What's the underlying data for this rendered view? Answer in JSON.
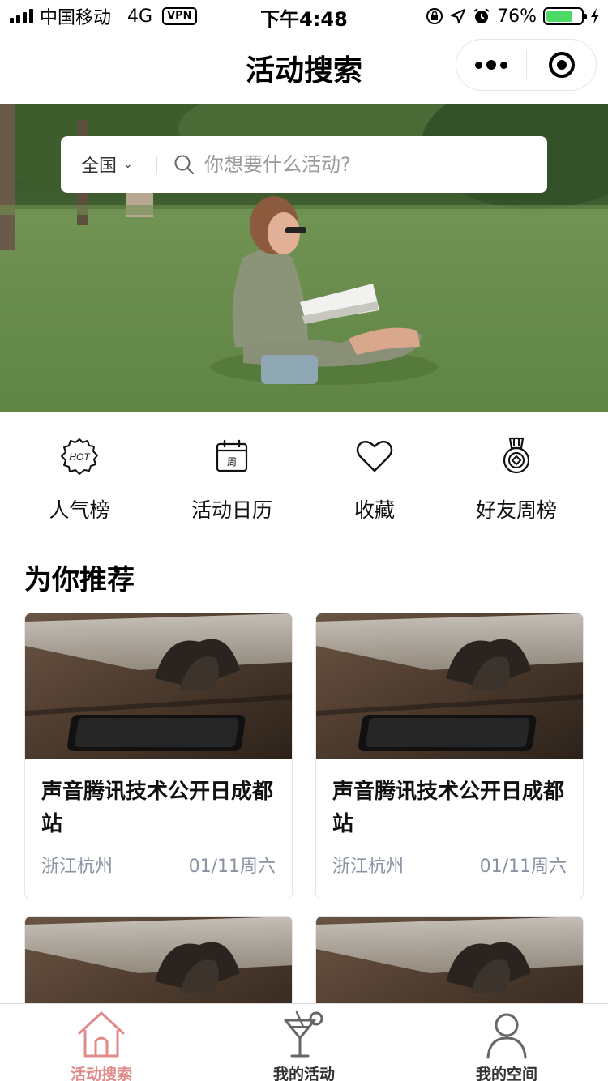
{
  "status_bar": {
    "carrier": "中国移动",
    "network": "4G",
    "vpn": "VPN",
    "time": "下午4:48",
    "battery": "76%",
    "battery_level": 0.76
  },
  "nav": {
    "title": "活动搜索"
  },
  "search": {
    "region": "全国",
    "placeholder": "你想要什么活动?"
  },
  "quick_menu": [
    {
      "label": "人气榜",
      "icon": "hot-badge-icon"
    },
    {
      "label": "活动日历",
      "icon": "calendar-icon",
      "icon_text": "周"
    },
    {
      "label": "收藏",
      "icon": "heart-icon"
    },
    {
      "label": "好友周榜",
      "icon": "medal-icon"
    }
  ],
  "section": {
    "title": "为你推荐"
  },
  "cards": [
    {
      "title": "声音腾讯技术公开日成都站",
      "location": "浙江杭州",
      "date": "01/11周六"
    },
    {
      "title": "声音腾讯技术公开日成都站",
      "location": "浙江杭州",
      "date": "01/11周六"
    },
    {
      "title": "",
      "location": "",
      "date": ""
    },
    {
      "title": "",
      "location": "",
      "date": ""
    }
  ],
  "tabs": [
    {
      "label": "活动搜索",
      "icon": "home-icon",
      "active": true
    },
    {
      "label": "我的活动",
      "icon": "cocktail-icon",
      "active": false
    },
    {
      "label": "我的空间",
      "icon": "person-icon",
      "active": false
    }
  ],
  "colors": {
    "tab_active": "#e08a8a",
    "meta_text": "#8a93a3",
    "battery_fill": "#4cd964"
  },
  "hot_text": "HOT"
}
